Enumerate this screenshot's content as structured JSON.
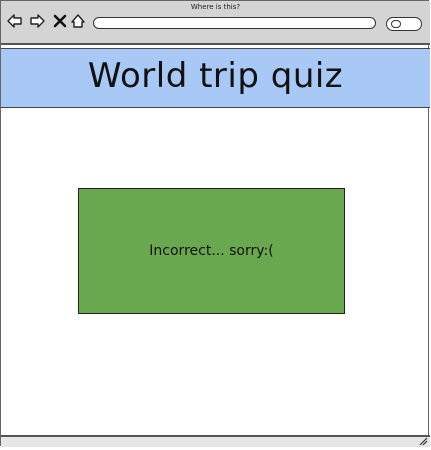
{
  "window": {
    "title": "Where is this?"
  },
  "browser": {
    "icons": [
      "back-arrow-icon",
      "forward-arrow-icon",
      "close-icon",
      "home-icon",
      "search-icon"
    ],
    "address_value": ""
  },
  "header": {
    "title": "World trip quiz",
    "background": "#a8c8f5"
  },
  "result": {
    "message": "Incorrect... sorry:(",
    "background": "#6aa84f"
  }
}
